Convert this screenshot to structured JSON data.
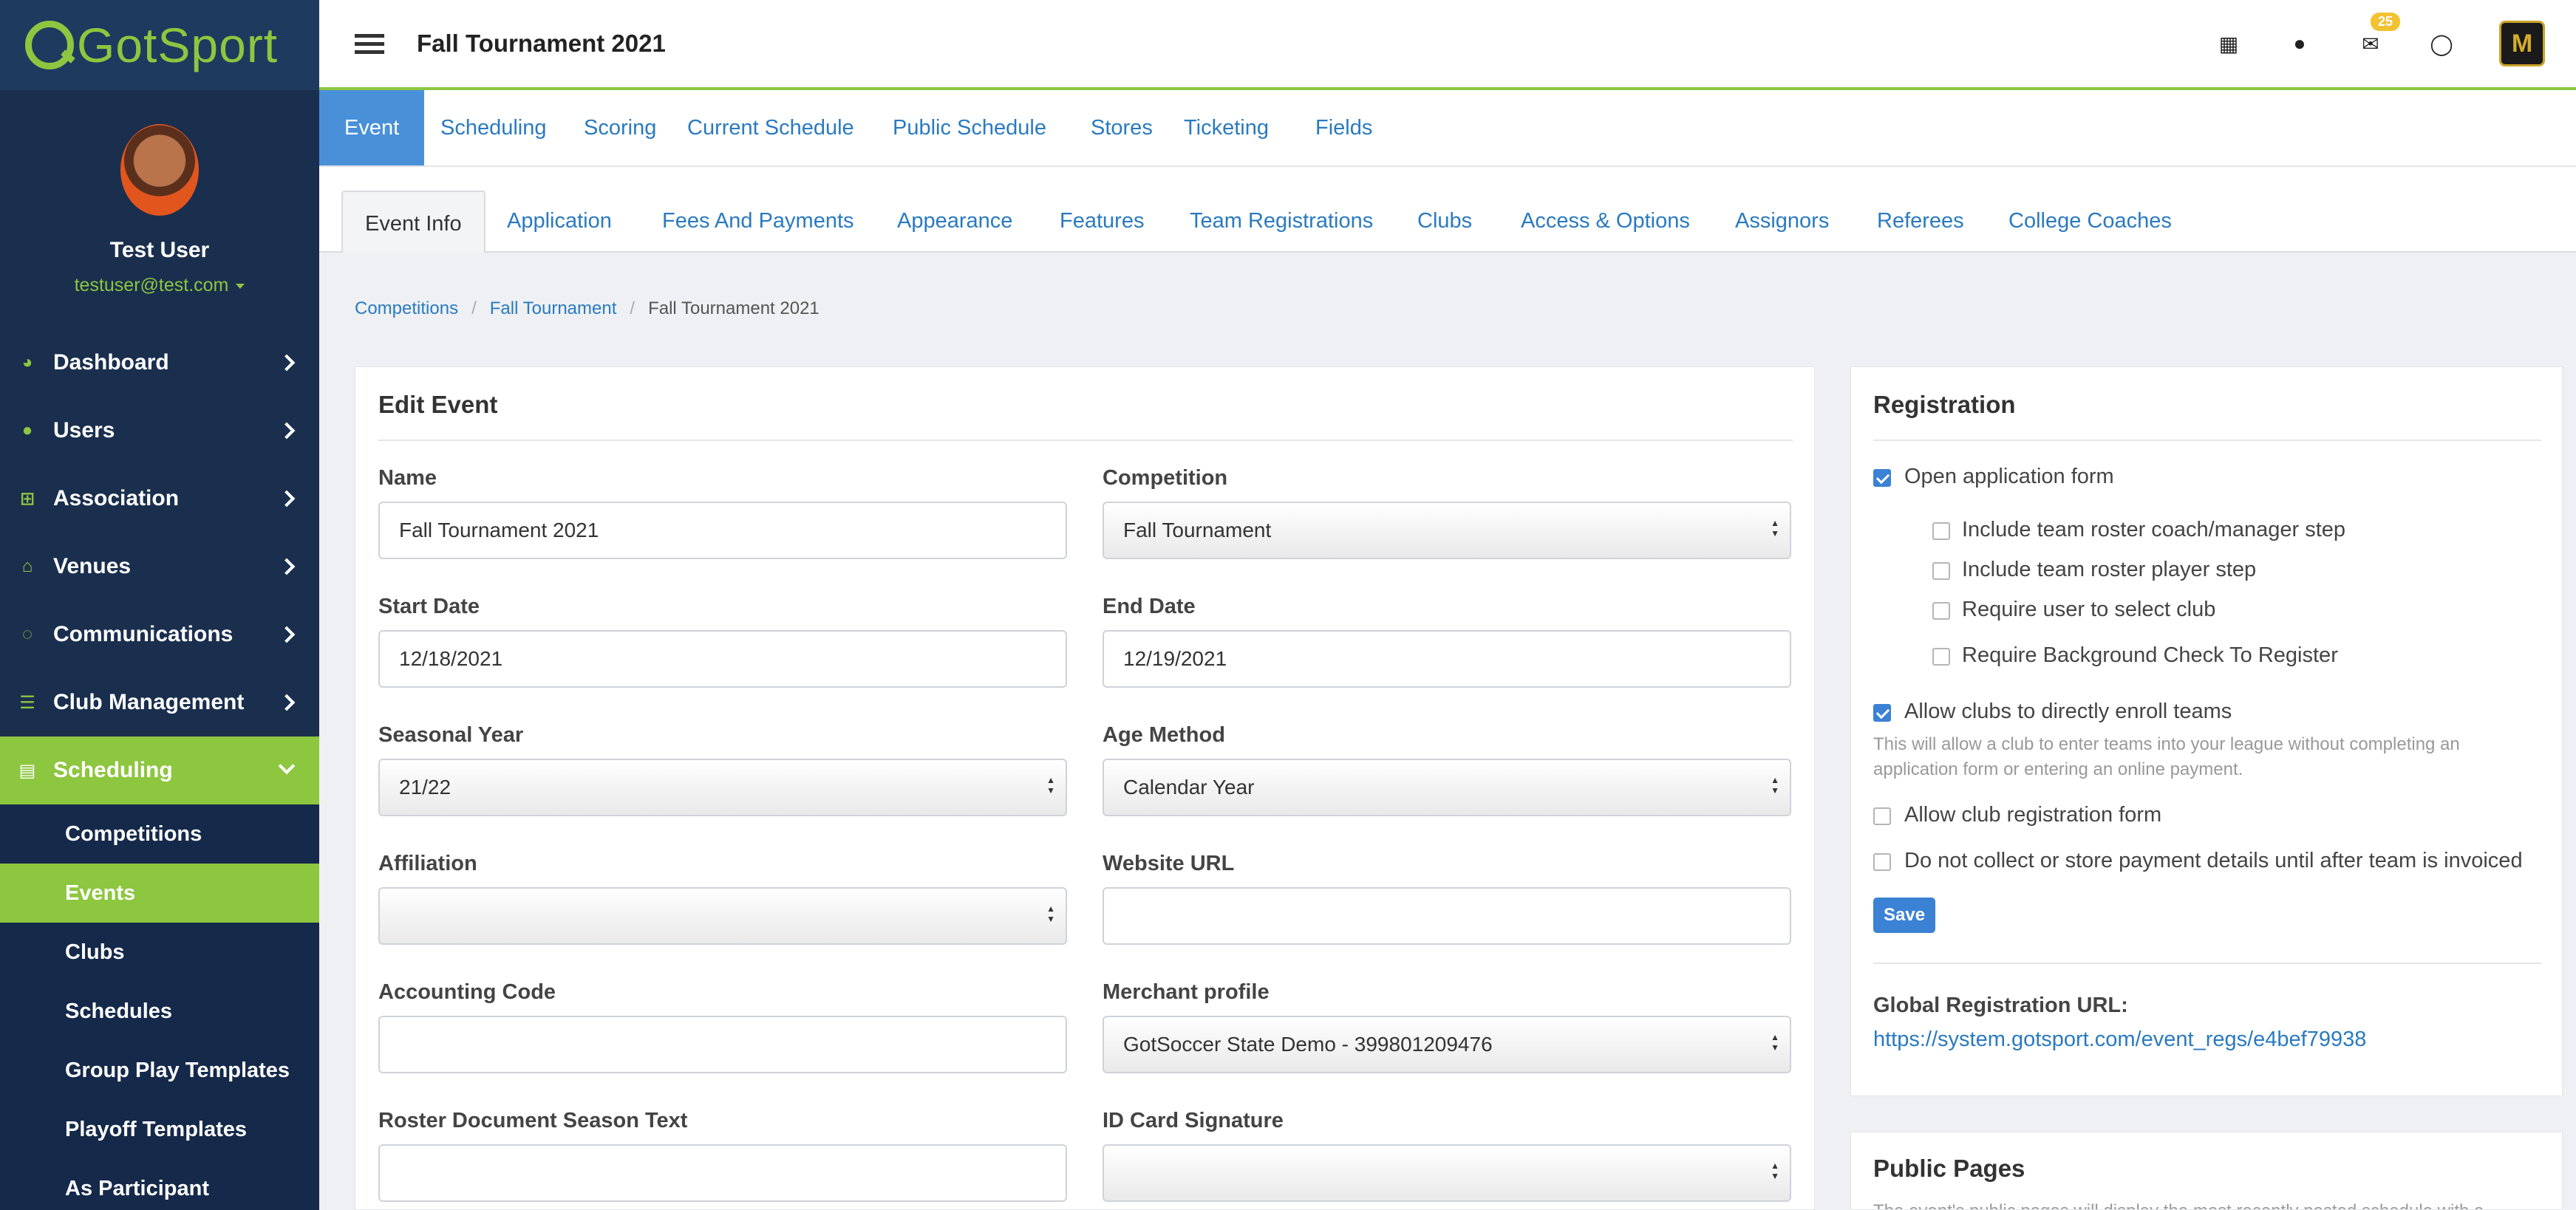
{
  "brand": {
    "name": "GotSport",
    "accent": "#8dc63f",
    "sidebar_bg": "#1a2f4e",
    "link": "#2a7ac0"
  },
  "user": {
    "name": "Test User",
    "email": "testuser@test.com"
  },
  "sidebar": {
    "items": [
      {
        "label": "Dashboard",
        "icon": "dashboard-icon"
      },
      {
        "label": "Users",
        "icon": "users-icon"
      },
      {
        "label": "Association",
        "icon": "sitemap-icon"
      },
      {
        "label": "Venues",
        "icon": "home-icon"
      },
      {
        "label": "Communications",
        "icon": "comments-icon"
      },
      {
        "label": "Club Management",
        "icon": "list-icon"
      },
      {
        "label": "Scheduling",
        "icon": "calendar-list-icon"
      }
    ],
    "sub_items": [
      "Competitions",
      "Events",
      "Clubs",
      "Schedules",
      "Group Play Templates",
      "Playoff Templates",
      "As Participant"
    ]
  },
  "header": {
    "title": "Fall Tournament 2021",
    "mail_count": "25"
  },
  "tabs_primary": [
    "Event",
    "Scheduling",
    "Scoring",
    "Current Schedule",
    "Public Schedule",
    "Stores",
    "Ticketing",
    "Fields"
  ],
  "tabs_secondary": [
    "Event Info",
    "Application",
    "Fees And Payments",
    "Appearance",
    "Features",
    "Team Registrations",
    "Clubs",
    "Access & Options",
    "Assignors",
    "Referees",
    "College Coaches"
  ],
  "breadcrumb": [
    "Competitions",
    "Fall Tournament",
    "Fall Tournament 2021"
  ],
  "edit_event": {
    "title": "Edit Event",
    "fields": {
      "name": {
        "label": "Name",
        "value": "Fall Tournament 2021"
      },
      "competition": {
        "label": "Competition",
        "value": "Fall Tournament"
      },
      "start_date": {
        "label": "Start Date",
        "value": "12/18/2021"
      },
      "end_date": {
        "label": "End Date",
        "value": "12/19/2021"
      },
      "seasonal_year": {
        "label": "Seasonal Year",
        "value": "21/22"
      },
      "age_method": {
        "label": "Age Method",
        "value": "Calendar Year"
      },
      "affiliation": {
        "label": "Affiliation",
        "value": ""
      },
      "website_url": {
        "label": "Website URL",
        "value": ""
      },
      "accounting_code": {
        "label": "Accounting Code",
        "value": ""
      },
      "merchant_profile": {
        "label": "Merchant profile",
        "value": "GotSoccer State Demo - 399801209476"
      },
      "roster_doc_season": {
        "label": "Roster Document Season Text",
        "value": ""
      },
      "id_card_signature": {
        "label": "ID Card Signature",
        "value": ""
      }
    }
  },
  "registration": {
    "title": "Registration",
    "open_form": {
      "label": "Open application form",
      "checked": true
    },
    "sub_options": [
      {
        "label": "Include team roster coach/manager step",
        "checked": false
      },
      {
        "label": "Include team roster player step",
        "checked": false
      },
      {
        "label": "Require user to select club",
        "checked": false
      },
      {
        "label": "Require Background Check To Register",
        "checked": false
      }
    ],
    "allow_clubs": {
      "label": "Allow clubs to directly enroll teams",
      "checked": true
    },
    "allow_clubs_help_1": "This will allow a club to enter teams into your league without completing an",
    "allow_clubs_help_2": "application form or entering an online payment.",
    "allow_club_reg": {
      "label": "Allow club registration form",
      "checked": false
    },
    "no_payment": {
      "label": "Do not collect or store payment details until after team is invoiced",
      "checked": false
    },
    "save_label": "Save",
    "global_url_label": "Global Registration URL:",
    "global_url": "https://system.gotsport.com/event_regs/e4bef79938"
  },
  "public_pages": {
    "title": "Public Pages",
    "text": "The event's public pages will display the most recently posted schedule with a"
  }
}
